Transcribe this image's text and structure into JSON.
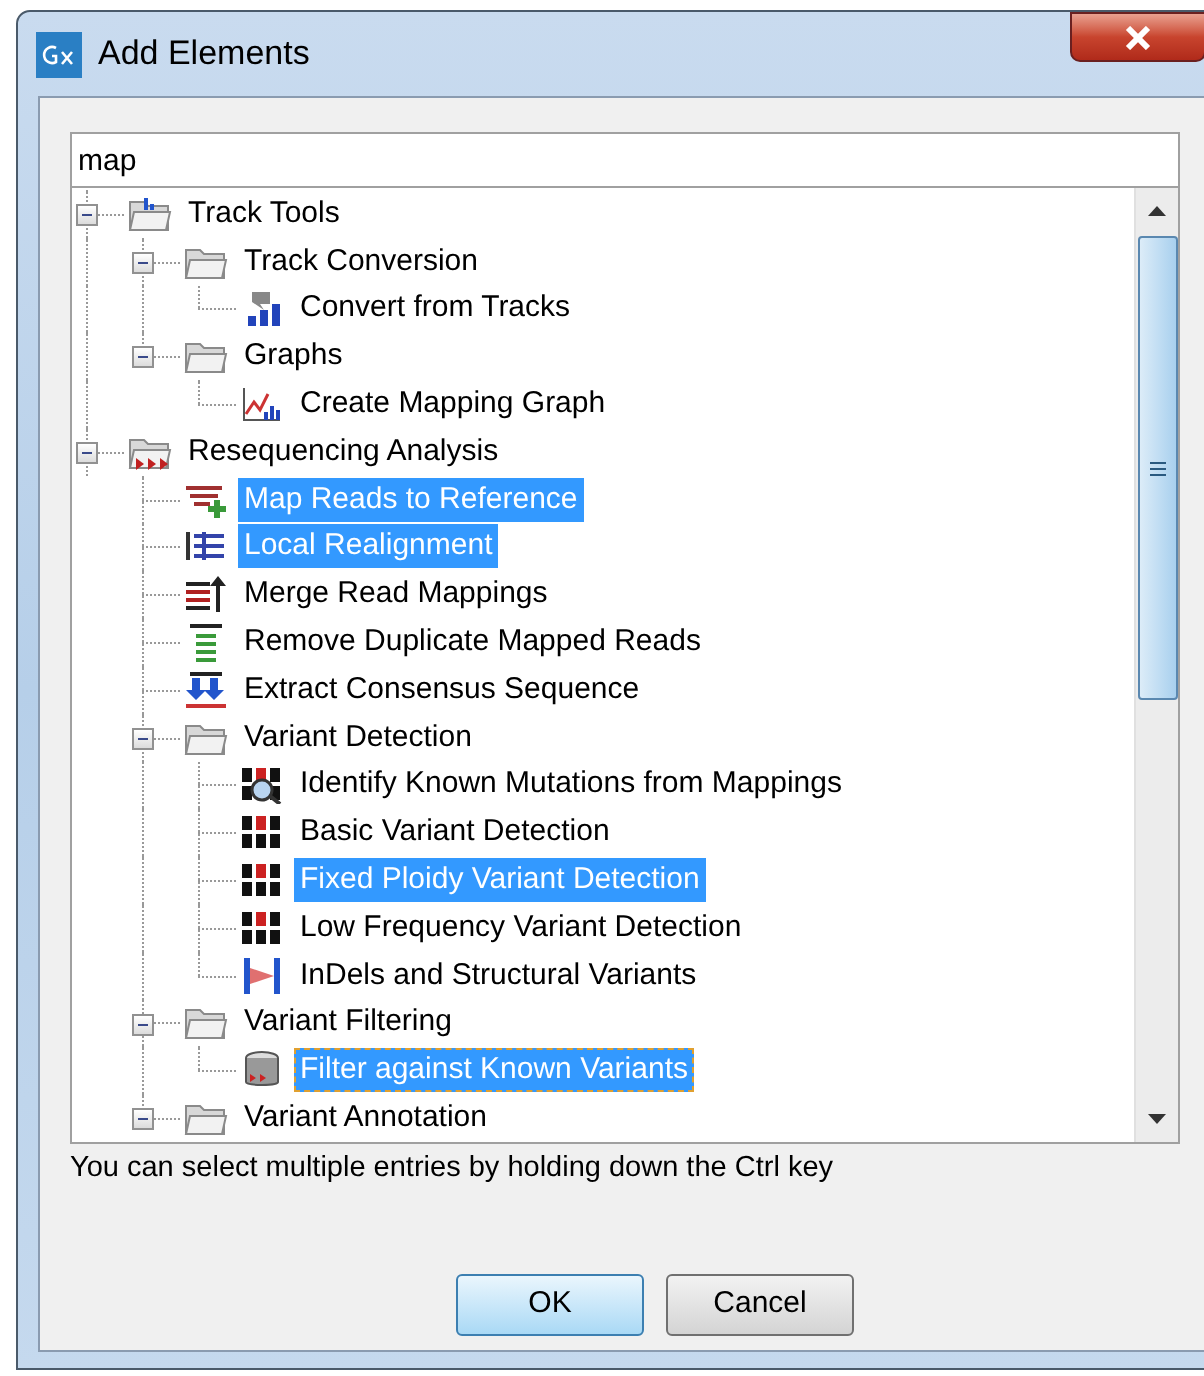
{
  "window": {
    "title": "Add Elements"
  },
  "search": {
    "value": "map"
  },
  "tree": [
    {
      "label": "Track Tools",
      "kind": "track-folder",
      "expanded": true,
      "selected": false,
      "focused": false,
      "children": [
        {
          "label": "Track Conversion",
          "kind": "folder",
          "expanded": true,
          "selected": false,
          "focused": false,
          "children": [
            {
              "label": "Convert from Tracks",
              "kind": "convert",
              "selected": false,
              "focused": false
            }
          ]
        },
        {
          "label": "Graphs",
          "kind": "folder",
          "expanded": true,
          "selected": false,
          "focused": false,
          "children": [
            {
              "label": "Create Mapping Graph",
              "kind": "graph",
              "selected": false,
              "focused": false
            }
          ]
        }
      ]
    },
    {
      "label": "Resequencing Analysis",
      "kind": "reseq-folder",
      "expanded": true,
      "selected": false,
      "focused": false,
      "children": [
        {
          "label": "Map Reads to Reference",
          "kind": "map",
          "selected": true,
          "focused": false
        },
        {
          "label": "Local Realignment",
          "kind": "realign",
          "selected": true,
          "focused": false
        },
        {
          "label": "Merge Read Mappings",
          "kind": "merge",
          "selected": false,
          "focused": false
        },
        {
          "label": "Remove Duplicate Mapped Reads",
          "kind": "dedupe",
          "selected": false,
          "focused": false
        },
        {
          "label": "Extract Consensus Sequence",
          "kind": "consensus",
          "selected": false,
          "focused": false
        },
        {
          "label": "Variant Detection",
          "kind": "folder",
          "expanded": true,
          "selected": false,
          "focused": false,
          "children": [
            {
              "label": "Identify Known Mutations from Mappings",
              "kind": "variant-search",
              "selected": false,
              "focused": false
            },
            {
              "label": "Basic Variant Detection",
              "kind": "variant",
              "selected": false,
              "focused": false
            },
            {
              "label": "Fixed Ploidy Variant Detection",
              "kind": "variant",
              "selected": true,
              "focused": false
            },
            {
              "label": "Low Frequency Variant Detection",
              "kind": "variant",
              "selected": false,
              "focused": false
            },
            {
              "label": "InDels and Structural Variants",
              "kind": "indel",
              "selected": false,
              "focused": false
            }
          ]
        },
        {
          "label": "Variant Filtering",
          "kind": "folder",
          "expanded": true,
          "selected": false,
          "focused": false,
          "children": [
            {
              "label": "Filter against Known Variants",
              "kind": "filter",
              "selected": true,
              "focused": true
            }
          ]
        },
        {
          "label": "Variant Annotation",
          "kind": "folder",
          "expanded": true,
          "selected": false,
          "focused": false
        }
      ]
    }
  ],
  "hint": "You can select multiple entries by holding down the Ctrl key",
  "buttons": [
    {
      "label": "OK",
      "default": true
    },
    {
      "label": "Cancel",
      "default": false
    }
  ]
}
